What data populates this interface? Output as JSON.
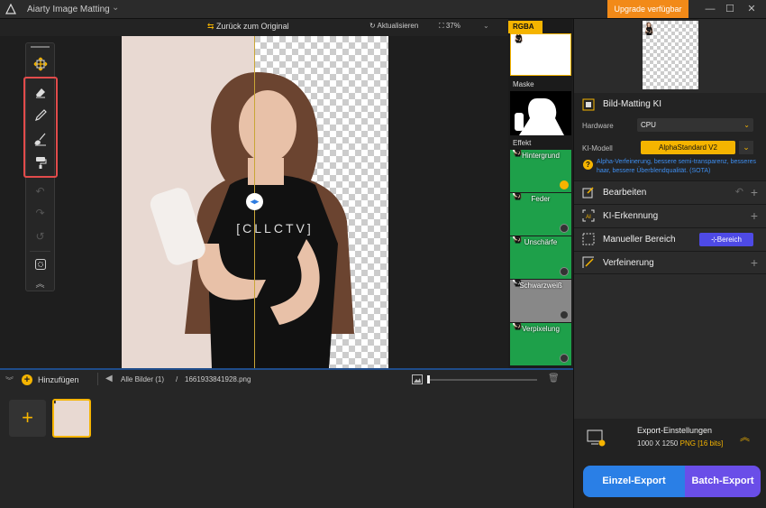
{
  "app": {
    "title": "Aiarty Image Matting",
    "upgrade": "Upgrade verfügbar",
    "minimize": "—",
    "maximize": "☐",
    "close": "✕"
  },
  "toolbar": {
    "back_to_original": "Zurück zum Original",
    "refresh": "Aktualisieren",
    "zoom": "37%"
  },
  "canvas": {
    "split_position_fraction": 0.5
  },
  "effects": {
    "rgba_label": "RGBA",
    "mask_label": "Maske",
    "effect_label": "Effekt",
    "items": [
      {
        "name": "Hintergrund"
      },
      {
        "name": "Feder"
      },
      {
        "name": "Unschärfe"
      },
      {
        "name": "Schwarzweiß"
      },
      {
        "name": "Verpixelung"
      }
    ]
  },
  "right_panel": {
    "matting_title": "Bild-Matting KI",
    "hardware_label": "Hardware",
    "hardware_value": "CPU",
    "model_label": "KI-Modell",
    "model_value": "AlphaStandard  V2",
    "model_desc": "Alpha-Verfeinerung, bessere semi-transparenz, besseres haar, bessere Überblendqualität. (SOTA)",
    "sections": [
      {
        "label": "Bearbeiten"
      },
      {
        "label": "KI-Erkennung"
      },
      {
        "label": "Manueller Bereich",
        "action": "Bereich"
      },
      {
        "label": "Verfeinerung"
      }
    ]
  },
  "bottom": {
    "add_label": "Hinzufügen",
    "all_images": "Alle Bilder (1)",
    "separator": "/",
    "filename": "1661933841928.png"
  },
  "export": {
    "title": "Export-Einstellungen",
    "size": "1000 X 1250",
    "format": "PNG",
    "bits": "[16 bits]",
    "einzel": "Einzel-Export",
    "batch": "Batch-Export"
  },
  "colors": {
    "accent": "#f5b400",
    "orange": "#f28a18",
    "blue": "#2a7fe6",
    "purple": "#6a4ee8",
    "highlight_red": "#e24b4b"
  }
}
